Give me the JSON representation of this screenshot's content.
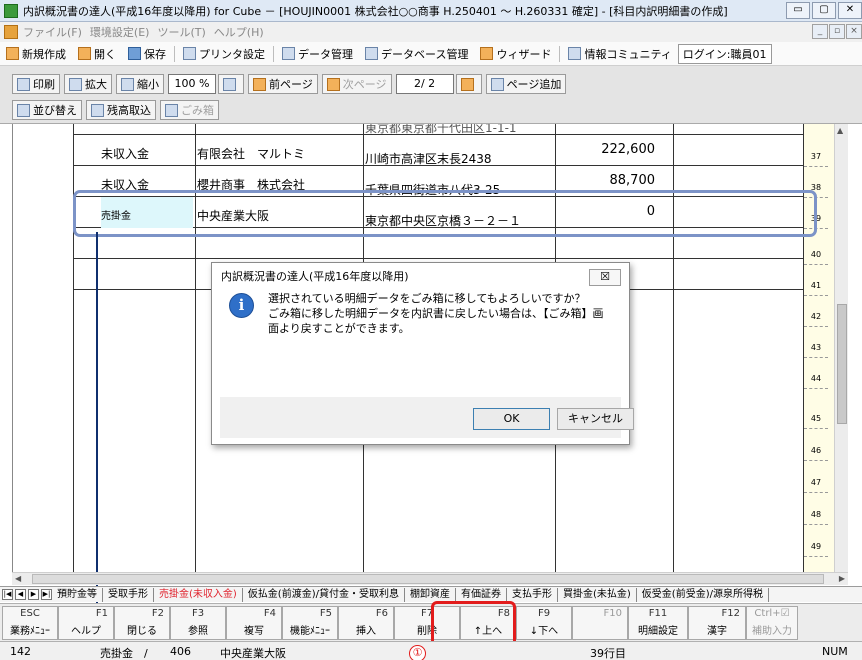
{
  "window": {
    "title": "内訳概況書の達人(平成16年度以降用) for Cube － [HOUJIN0001 株式会社○○商事 H.250401 ～ H.260331 確定] - [科目内訳明細書の作成]",
    "buttons": [
      "▭",
      "▢",
      "✕"
    ]
  },
  "menu": {
    "items": [
      "ファイル(F)",
      "環境設定(E)",
      "ツール(T)",
      "ヘルプ(H)"
    ],
    "mdi_buttons": [
      "_",
      "▫",
      "×"
    ]
  },
  "toolbar1": {
    "items": [
      "新規作成",
      "開く",
      "保存",
      "プリンタ設定",
      "データ管理",
      "データベース管理",
      "ウィザード",
      "情報コミュニティ"
    ],
    "login": "ログイン:職員01"
  },
  "toolbar2": {
    "print": "印刷",
    "zoom_in": "拡大",
    "zoom_out": "縮小",
    "zoom_value": "100 %",
    "prev_page": "前ページ",
    "next_page": "次ページ",
    "page_value": "2/ 2",
    "add_page": "ページ追加",
    "sort": "並び替え",
    "balance_import": "残高取込",
    "trash": "ごみ箱"
  },
  "rows": [
    {
      "account": "",
      "name": "",
      "address": "東京都東京都千代田区1-1-1",
      "amount": "",
      "num": ""
    },
    {
      "account": "未収入金",
      "name": "有限会社　マルトミ",
      "address": "川崎市高津区末長2438",
      "amount": "222,600",
      "num": "37"
    },
    {
      "account": "未収入金",
      "name": "櫻井商事　株式会社",
      "address": "千葉県四街道市八代3-25",
      "amount": "88,700",
      "num": "38"
    },
    {
      "account": "売掛金",
      "name": "中央産業大阪",
      "address": "東京都中央区京橋３－２－１",
      "amount": "0",
      "num": "39"
    }
  ],
  "row_numbers": [
    "40",
    "41",
    "42",
    "43",
    "44",
    "45",
    "46",
    "47",
    "48",
    "49"
  ],
  "dialog": {
    "title": "内訳概況書の達人(平成16年度以降用)",
    "close": "☒",
    "message_line1": "選択されている明細データをごみ箱に移してもよろしいですか？",
    "message_line2": "ごみ箱に移した明細データを内訳書に戻したい場合は、【ごみ箱】画",
    "message_line3": "面より戻すことができます。",
    "ok": "OK",
    "cancel": "キャンセル"
  },
  "tabs": [
    "預貯金等",
    "受取手形",
    "売掛金(未収入金)",
    "仮払金(前渡金)/貸付金・受取利息",
    "棚卸資産",
    "有価証券",
    "支払手形",
    "買掛金(未払金)",
    "仮受金(前受金)/源泉所得税"
  ],
  "fkeys": [
    {
      "key": "ESC",
      "label": "業務ﾒﾆｭｰ"
    },
    {
      "key": "F1",
      "label": "ヘルプ"
    },
    {
      "key": "F2",
      "label": "閉じる"
    },
    {
      "key": "F3",
      "label": "参照"
    },
    {
      "key": "F4",
      "label": "複写"
    },
    {
      "key": "F5",
      "label": "機能ﾒﾆｭｰ"
    },
    {
      "key": "F6",
      "label": "挿入"
    },
    {
      "key": "F7",
      "label": "削除"
    },
    {
      "key": "F8",
      "label": "↑上へ"
    },
    {
      "key": "F9",
      "label": "↓下へ"
    },
    {
      "key": "F10",
      "label": ""
    },
    {
      "key": "F11",
      "label": "明細設定"
    },
    {
      "key": "F12",
      "label": "漢字"
    },
    {
      "key": "Ctrl+☑",
      "label": "補助入力"
    }
  ],
  "annotation": "①",
  "status": {
    "code": "142",
    "account": "売掛金　/",
    "number": "406",
    "name": "中央産業大阪",
    "row": "39行目",
    "numlock": "NUM"
  }
}
